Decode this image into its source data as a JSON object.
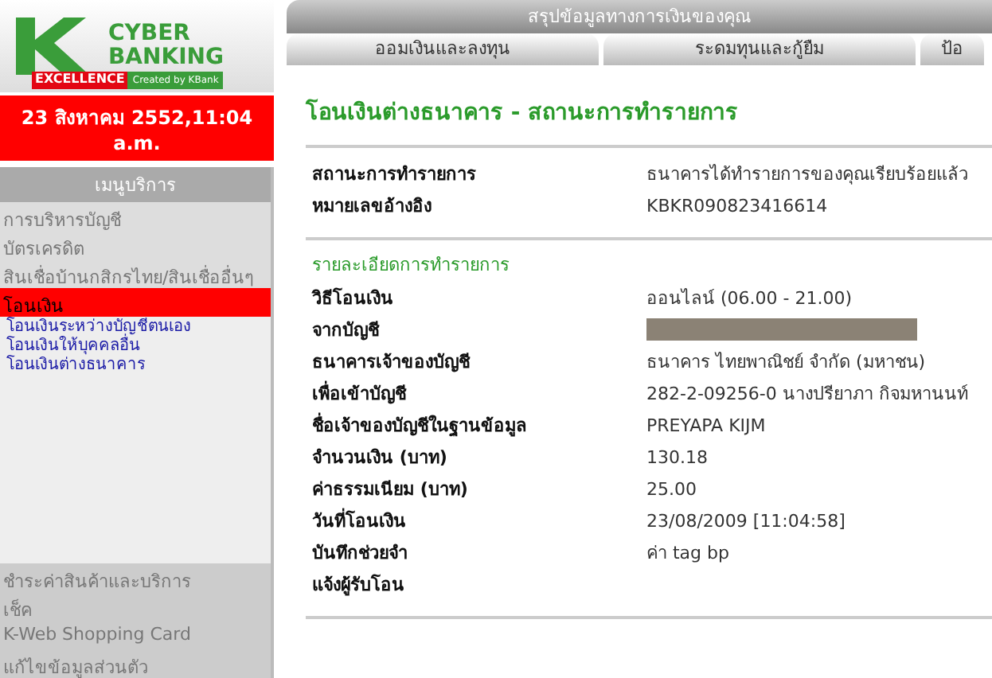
{
  "logo": {
    "title": "CYBER",
    "subtitle": "BANKING",
    "tagline": "EXCELLENCE",
    "credit": "Created by KBank"
  },
  "datetime": "23 สิงหาคม 2552,11:04 a.m.",
  "menu": {
    "header": "เมนูบริการ",
    "items": [
      {
        "label": "การบริหารบัญชี",
        "selected": false
      },
      {
        "label": "บัตรเครดิต",
        "selected": false
      },
      {
        "label": "สินเชื่อบ้านกสิกรไทย/สินเชื่ออื่นๆ",
        "selected": false
      },
      {
        "label": "โอนเงิน",
        "selected": true,
        "children": [
          {
            "label": "โอนเงินระหว่างบัญชีตนเอง"
          },
          {
            "label": "โอนเงินให้บุคคลอื่น"
          },
          {
            "label": "โอนเงินต่างธนาคาร"
          }
        ]
      },
      {
        "label": "ชำระค่าสินค้าและบริการ",
        "selected": false
      },
      {
        "label": "เช็ค",
        "selected": false
      },
      {
        "label": "K-Web Shopping Card",
        "selected": false
      },
      {
        "label": "แก้ไขข้อมูลส่วนตัว",
        "selected": false
      }
    ]
  },
  "top_tab": "สรุปข้อมูลทางการเงินของคุณ",
  "tabs": [
    "ออมเงินและลงทุน",
    "ระดมทุนและกู้ยืม",
    "ป้อ"
  ],
  "page_title": "โอนเงินต่างธนาคาร - สถานะการทำรายการ",
  "status_rows": [
    {
      "label": "สถานะการทำรายการ",
      "value": "ธนาคารได้ทำรายการของคุณเรียบร้อยแล้ว"
    },
    {
      "label": "หมายเลขอ้างอิง",
      "value": "KBKR090823416614"
    }
  ],
  "details_title": "รายละเอียดการทำรายการ",
  "detail_rows": [
    {
      "kind": "text",
      "label": "วิธีโอนเงิน",
      "value": "ออนไลน์ (06.00 - 21.00)"
    },
    {
      "kind": "redacted",
      "label": "จากบัญชี"
    },
    {
      "kind": "text",
      "label": "ธนาคารเจ้าของบัญชี",
      "value": "ธนาคาร ไทยพาณิชย์ จำกัด (มหาชน)"
    },
    {
      "kind": "text",
      "label": "เพื่อเข้าบัญชี",
      "value": "282-2-09256-0 นางปรียาภา กิจมหานนท์"
    },
    {
      "kind": "text",
      "label": "ชื่อเจ้าของบัญชีในฐานข้อมูล",
      "value": "PREYAPA KIJM"
    },
    {
      "kind": "text",
      "label": "จำนวนเงิน (บาท)",
      "value": "130.18"
    },
    {
      "kind": "text",
      "label": "ค่าธรรมเนียม (บาท)",
      "value": "25.00"
    },
    {
      "kind": "text",
      "label": "วันที่โอนเงิน",
      "value": "23/08/2009 [11:04:58]"
    },
    {
      "kind": "text",
      "label": "บันทึกช่วยจำ",
      "value": "ค่า tag bp"
    },
    {
      "kind": "text",
      "label": "แจ้งผู้รับโอน"
    }
  ]
}
